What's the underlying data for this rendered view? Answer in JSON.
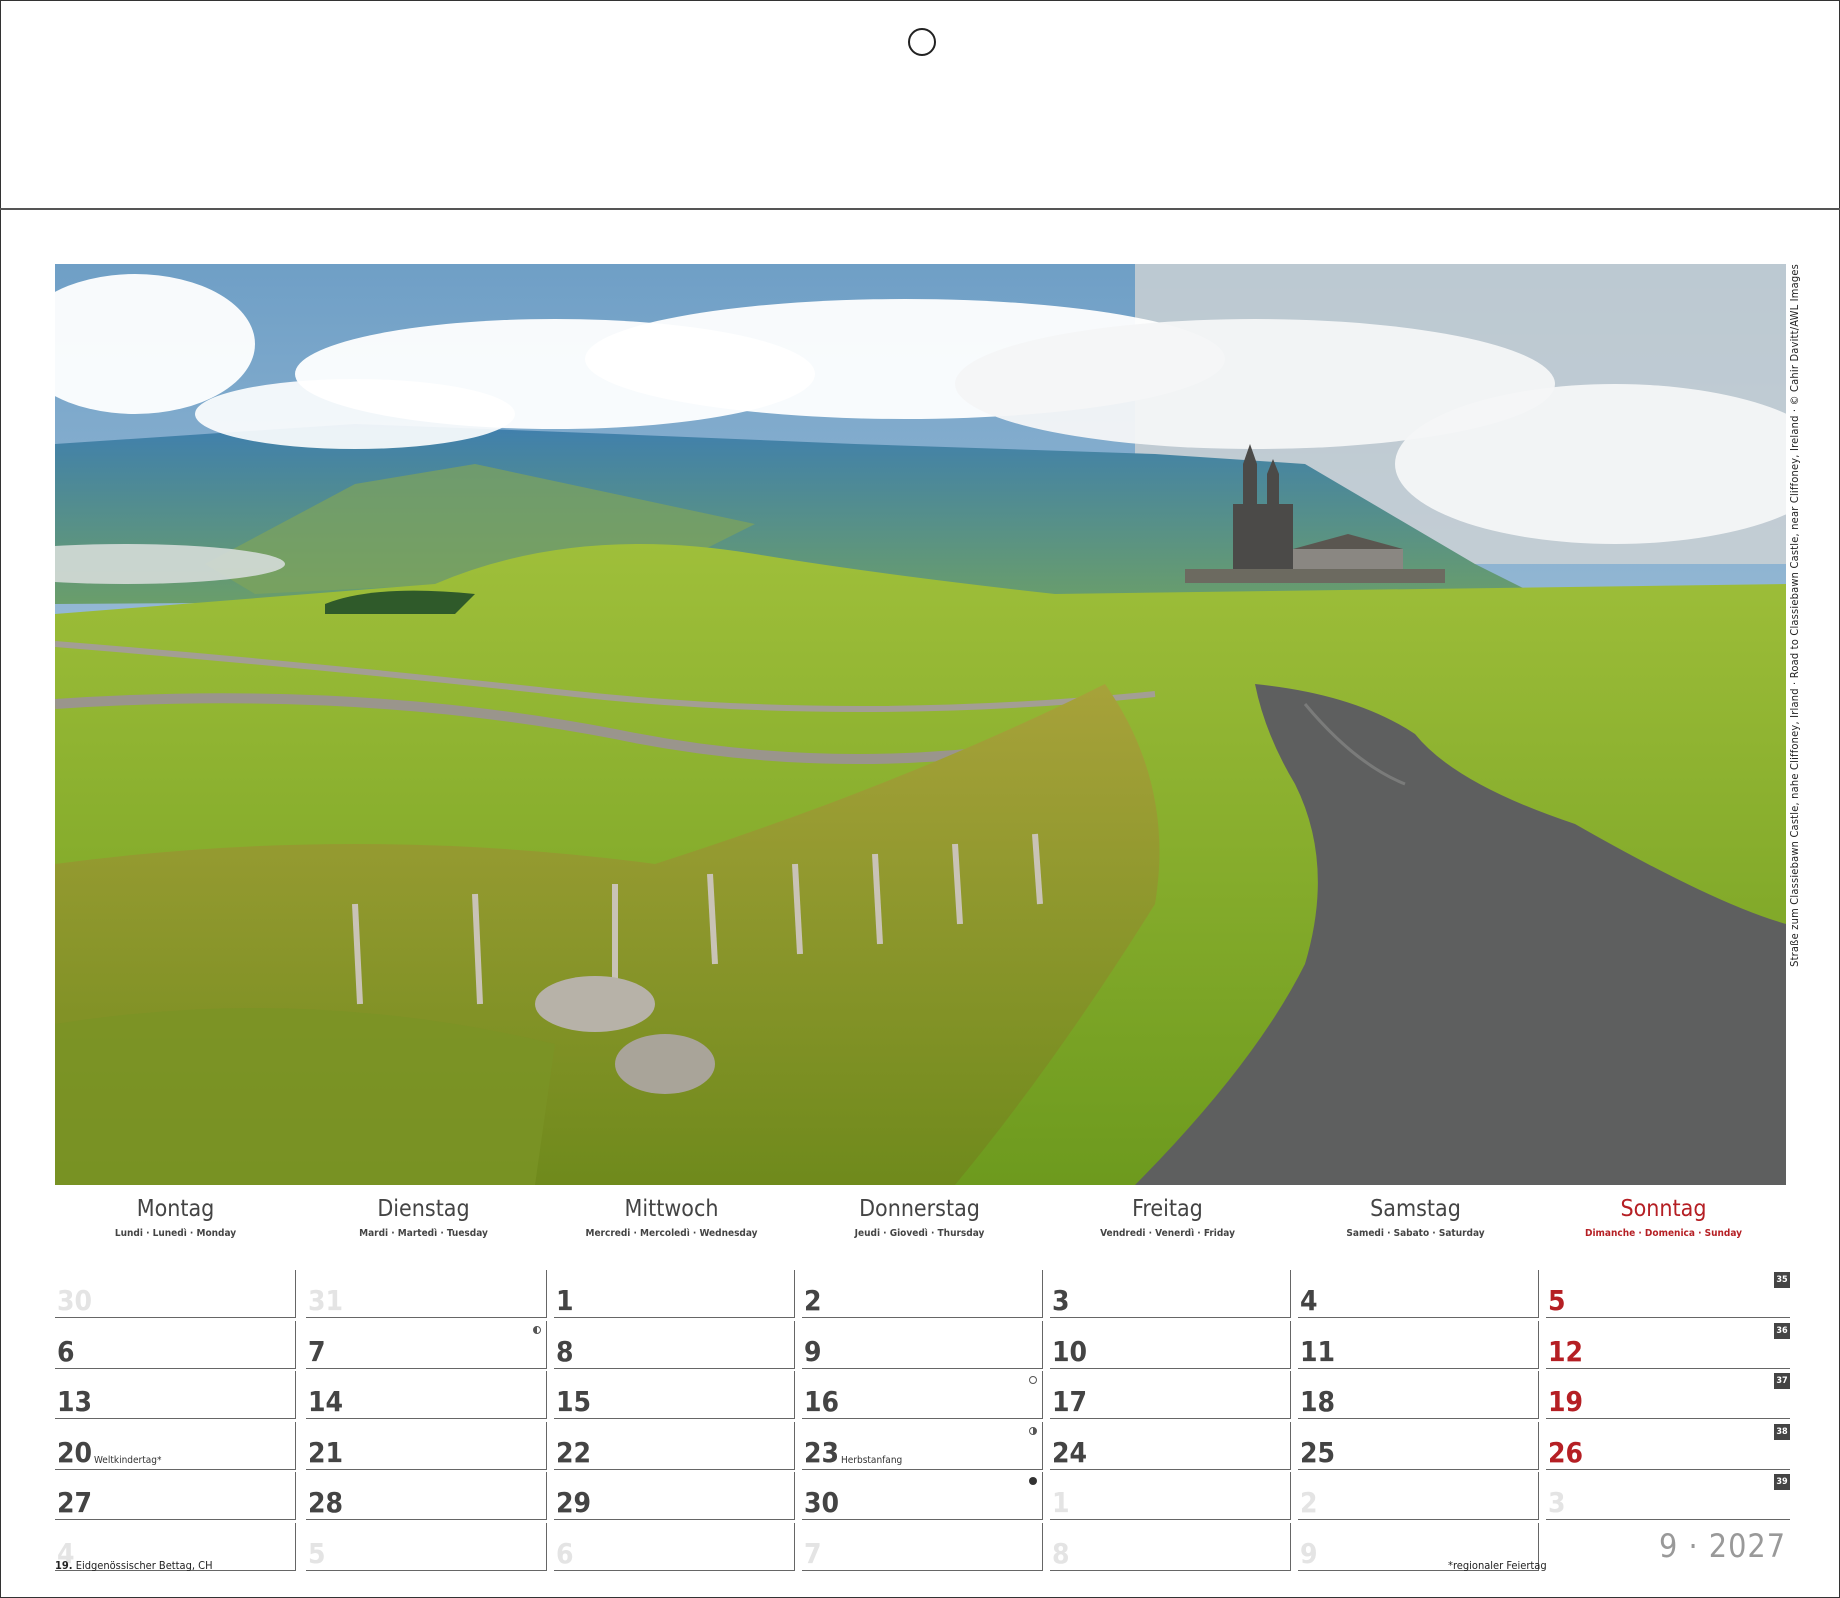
{
  "photo": {
    "caption": "Straße zum Classiebawn Castle, nahe Cliffoney, Irland · Road to Classiebawn Castle, near Cliffoney, Ireland · © Cahir Davitt/AWL Images"
  },
  "calendar": {
    "days": [
      {
        "name": "Montag",
        "sub": "Lundi · Lunedì · Monday"
      },
      {
        "name": "Dienstag",
        "sub": "Mardi · Martedì · Tuesday"
      },
      {
        "name": "Mittwoch",
        "sub": "Mercredi · Mercoledì · Wednesday"
      },
      {
        "name": "Donnerstag",
        "sub": "Jeudi · Giovedì · Thursday"
      },
      {
        "name": "Freitag",
        "sub": "Vendredi · Venerdì · Friday"
      },
      {
        "name": "Samstag",
        "sub": "Samedi · Sabato · Saturday"
      },
      {
        "name": "Sonntag",
        "sub": "Dimanche · Domenica · Sunday"
      }
    ],
    "weeks": [
      "35",
      "36",
      "37",
      "38",
      "39"
    ],
    "rows": [
      [
        "30",
        "31",
        "1",
        "2",
        "3",
        "4",
        "5"
      ],
      [
        "6",
        "7",
        "8",
        "9",
        "10",
        "11",
        "12"
      ],
      [
        "13",
        "14",
        "15",
        "16",
        "17",
        "18",
        "19"
      ],
      [
        "20",
        "21",
        "22",
        "23",
        "24",
        "25",
        "26"
      ],
      [
        "27",
        "28",
        "29",
        "30",
        "1",
        "2",
        "3"
      ],
      [
        "4",
        "5",
        "6",
        "7",
        "8",
        "9",
        ""
      ]
    ],
    "notes": {
      "weltkindertag": "Weltkindertag*",
      "herbstanfang": "Herbstanfang"
    },
    "month_label": "9 · 2027"
  },
  "footer": {
    "holiday_day": "19.",
    "holiday_text": "Eidgenössischer Bettag, CH",
    "regional_note": "*regionaler Feiertag"
  },
  "colors": {
    "sunday": "#b51f24",
    "text": "#444444"
  }
}
